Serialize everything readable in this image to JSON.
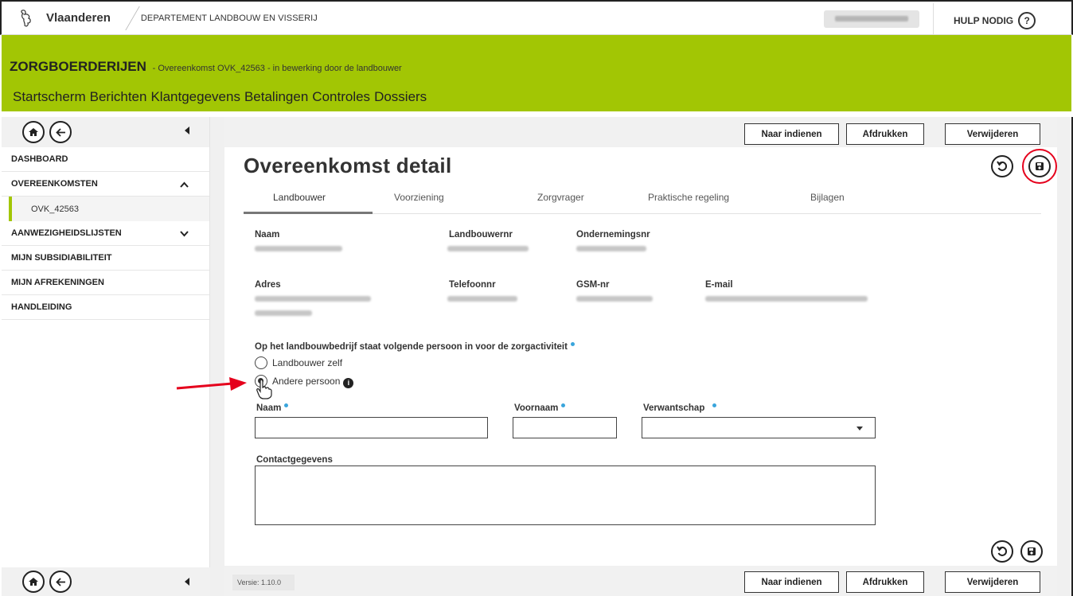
{
  "topbar": {
    "brand": "Vlaanderen",
    "department": "DEPARTEMENT LANDBOUW EN VISSERIJ",
    "help": "HULP NODIG",
    "help_icon": "?"
  },
  "header": {
    "title": "ZORGBOERDERIJEN",
    "subtitle": "- Overeenkomst OVK_42563 - in bewerking door de landbouwer",
    "nav": [
      "Startscherm",
      "Berichten",
      "Klantgegevens",
      "Betalingen",
      "Controles",
      "Dossiers"
    ]
  },
  "sidebar": {
    "items": [
      {
        "label": "DASHBOARD"
      },
      {
        "label": "OVEREENKOMSTEN"
      },
      {
        "label": "OVK_42563"
      },
      {
        "label": "AANWEZIGHEIDSLIJSTEN"
      },
      {
        "label": "MIJN SUBSIDIABILITEIT"
      },
      {
        "label": "MIJN AFREKENINGEN"
      },
      {
        "label": "HANDLEIDING"
      }
    ]
  },
  "actions": {
    "submit": "Naar indienen",
    "print": "Afdrukken",
    "delete": "Verwijderen"
  },
  "page": {
    "title": "Overeenkomst detail",
    "tabs": [
      "Landbouwer",
      "Voorziening",
      "Zorgvrager",
      "Praktische regeling",
      "Bijlagen"
    ],
    "active_tab": "Landbouwer"
  },
  "fields": {
    "naam": "Naam",
    "landbouwernr": "Landbouwernr",
    "ondernemingsnr": "Ondernemingsnr",
    "adres": "Adres",
    "telefoonnr": "Telefoonnr",
    "gsm": "GSM-nr",
    "email": "E-mail"
  },
  "question": {
    "text": "Op het landbouwbedrijf staat volgende persoon in voor de zorgactiviteit",
    "option1": "Landbouwer zelf",
    "option2": "Andere persoon",
    "selected": "Andere persoon"
  },
  "person_form": {
    "naam": "Naam",
    "voornaam": "Voornaam",
    "verwantschap": "Verwantschap",
    "contact": "Contactgegevens"
  },
  "footer": {
    "version": "Versie: 1.10.0"
  },
  "colors": {
    "brand_green": "#a2c604",
    "required_dot": "#3aa5dc",
    "highlight_red": "#e5001c"
  }
}
